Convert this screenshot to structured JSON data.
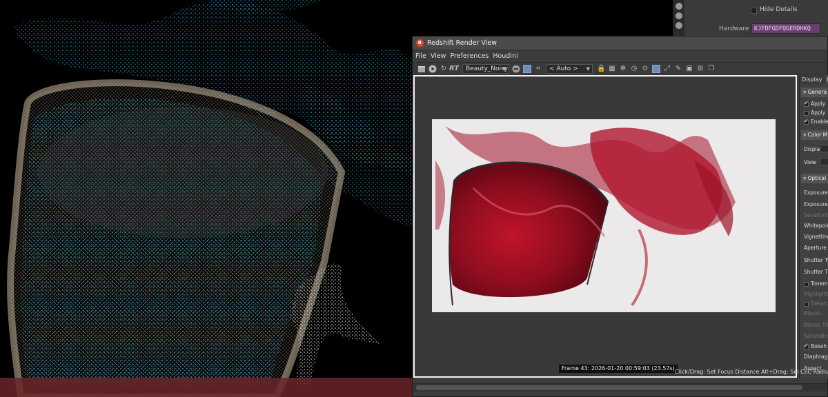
{
  "top_panel": {
    "hide_details_label": "Hide Details",
    "hardware_id_label": "Hardware ID",
    "hardware_id_value": "KJFDFGDFQGERDHKQ"
  },
  "render_view": {
    "title": "Redshift Render View",
    "menu": [
      "File",
      "View",
      "Preferences",
      "Houdini"
    ],
    "toolbar": {
      "rt_label": "RT",
      "aov_select": "Beauty_Noisy",
      "zoom_select": "< Auto >"
    },
    "frame_info": "Frame  43:  2026-01-20  00:59:03  (23.57s)",
    "hint": "Click/Drag: Set Focus Distance  Alt+Drag: Sel CoC Radius"
  },
  "side_panel": {
    "tabs": [
      "Display",
      "P"
    ],
    "sections": [
      "Genera",
      "Color M",
      "Optical"
    ],
    "rows": [
      {
        "label": "Apply",
        "check": true,
        "on": true,
        "dim": false
      },
      {
        "label": "Apply",
        "check": true,
        "on": false,
        "dim": false
      },
      {
        "label": "Enable",
        "check": true,
        "on": true,
        "dim": false
      },
      {
        "label": "Display",
        "check": false,
        "on": false,
        "dim": false
      },
      {
        "label": "View",
        "check": false,
        "on": false,
        "dim": false
      },
      {
        "label": "Exposure",
        "check": false,
        "on": false,
        "dim": false
      },
      {
        "label": "Exposure",
        "check": false,
        "on": false,
        "dim": false
      },
      {
        "label": "Sensitivity",
        "check": false,
        "on": false,
        "dim": true
      },
      {
        "label": "Whitepoin",
        "check": false,
        "on": false,
        "dim": false
      },
      {
        "label": "Vignetting",
        "check": false,
        "on": false,
        "dim": false
      },
      {
        "label": "Aperture (",
        "check": false,
        "on": false,
        "dim": false
      },
      {
        "label": "Shutter Ty",
        "check": false,
        "on": false,
        "dim": false
      },
      {
        "label": "Shutter Ti",
        "check": false,
        "on": false,
        "dim": false
      },
      {
        "label": "Tonem",
        "check": true,
        "on": false,
        "dim": false
      },
      {
        "label": "Highlights",
        "check": false,
        "on": false,
        "dim": true
      },
      {
        "label": "Desatu",
        "check": true,
        "on": false,
        "dim": true
      },
      {
        "label": "Blacks",
        "check": false,
        "on": false,
        "dim": true
      },
      {
        "label": "Blacks Th",
        "check": false,
        "on": false,
        "dim": true
      },
      {
        "label": "Saturation",
        "check": false,
        "on": false,
        "dim": true
      },
      {
        "label": "Bokeh",
        "check": true,
        "on": true,
        "dim": false
      },
      {
        "label": "Diaphragm",
        "check": false,
        "on": false,
        "dim": false
      },
      {
        "label": "Aspect",
        "check": false,
        "on": false,
        "dim": false
      }
    ]
  }
}
